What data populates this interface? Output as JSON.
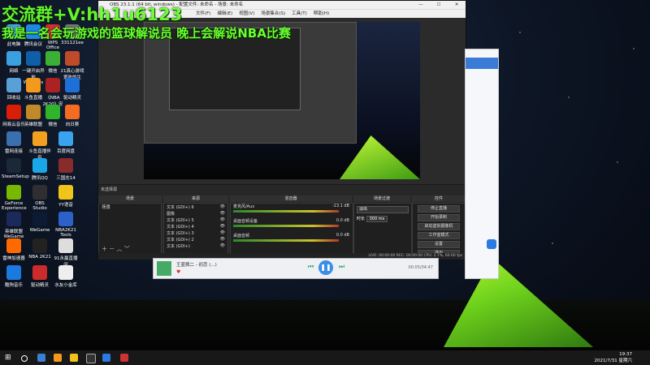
{
  "overlay": {
    "line1": "交流群+V:hh1u6123",
    "line2": "我是一名会玩游戏的篮球解说员 晚上会解说NBA比赛"
  },
  "desktop_icons": [
    {
      "label": "此电脑",
      "color": "#4aa3df"
    },
    {
      "label": "腾讯会议",
      "color": "#1e88e5"
    },
    {
      "label": "WPS Office",
      "color": "#d32f2f"
    },
    {
      "label": "331121ee",
      "color": "#777"
    },
    {
      "label": "网络",
      "color": "#3aa0e0"
    },
    {
      "label": "一键开启异地 Windows ...",
      "color": "#0f5fa8"
    },
    {
      "label": "微信",
      "color": "#3cb034"
    },
    {
      "label": "21真心游戏 爱吃的生命...",
      "color": "#c04b2a"
    },
    {
      "label": "回收站",
      "color": "#5aa0d8"
    },
    {
      "label": "斗鱼直播",
      "color": "#f39a1c"
    },
    {
      "label": "《NBA 2K20》安装..",
      "color": "#aa2222"
    },
    {
      "label": "驱动精灵",
      "color": "#1e6fd8"
    },
    {
      "label": "网易云音乐",
      "color": "#d81e06"
    },
    {
      "label": "英雄联盟",
      "color": "#c08a2a"
    },
    {
      "label": "微信",
      "color": "#2fb52c"
    },
    {
      "label": "向日葵",
      "color": "#f36c21"
    },
    {
      "label": "雷网连接",
      "color": "#3a6fb0"
    },
    {
      "label": "斗鱼直播伴侣",
      "color": "#f3a020"
    },
    {
      "label": "百度网盘",
      "color": "#3aa3ef"
    },
    {
      "label": "SteamSetup",
      "color": "#1b2838"
    },
    {
      "label": "腾讯QQ",
      "color": "#1aa7e8"
    },
    {
      "label": "三国志14",
      "color": "#8a2b2b"
    },
    {
      "label": "GeForce Experience",
      "color": "#76b900"
    },
    {
      "label": "OBS Studio",
      "color": "#302e31"
    },
    {
      "label": "YY语音",
      "color": "#f0c419"
    },
    {
      "label": "英雄联盟 WeGame版",
      "color": "#1b2a5a"
    },
    {
      "label": "WeGame",
      "color": "#0d1a33"
    },
    {
      "label": "NBA2K21 Tools",
      "color": "#2a62c9"
    },
    {
      "label": "雷神加速器",
      "color": "#ff6a00"
    },
    {
      "label": "NBA 2K21",
      "color": "#222"
    },
    {
      "label": "91永赢直播间",
      "color": "#ddd"
    },
    {
      "label": "酷狗音乐",
      "color": "#1b7ae0"
    },
    {
      "label": "驱动精灵",
      "color": "#cc2b2b"
    },
    {
      "label": "水友小金库",
      "color": "#eee"
    }
  ],
  "obs": {
    "title": "OBS 23.1.1 (64 bit, windows) - 配置文件: 未命名 - 场景: 未命名",
    "menu": [
      "文件(F)",
      "编辑(E)",
      "视图(V)",
      "场景集合(S)",
      "工具(T)",
      "帮助(H)"
    ],
    "filter_label": "未选择源",
    "tabs": [
      "场景",
      "来源",
      "混音器",
      "场景过渡",
      "控件"
    ],
    "scene_item": "场景",
    "sources": [
      "文本 (GDI+) 6",
      "图像",
      "文本 (GDI+) 5",
      "文本 (GDI+) 4",
      "文本 (GDI+) 3",
      "文本 (GDI+) 2",
      "文本 (GDI+)"
    ],
    "mixer": [
      {
        "name": "麦克风/Aux",
        "db": "-13.1 dB"
      },
      {
        "name": "桌面音频设备",
        "db": "0.0 dB"
      },
      {
        "name": "桌面音频",
        "db": "0.0 dB"
      }
    ],
    "transition": {
      "type": "淡出",
      "duration_label": "时长",
      "duration": "300 ms"
    },
    "controls": [
      "停止直播",
      "开始录制",
      "启动虚拟摄像机",
      "工作室模式",
      "设置",
      "退出"
    ],
    "status": "LIVE: 00:00:00   REC: 00:00:00   CPU: 2.7%, 60.00 fps"
  },
  "music": {
    "title": "王蓝佩二 - 初恋 (...)",
    "time": "00:05/04:47"
  },
  "taskbar": {
    "time": "19:37",
    "date": "2021/7/31 星期六"
  },
  "colors": {
    "accent_green": "#6aff2e"
  }
}
